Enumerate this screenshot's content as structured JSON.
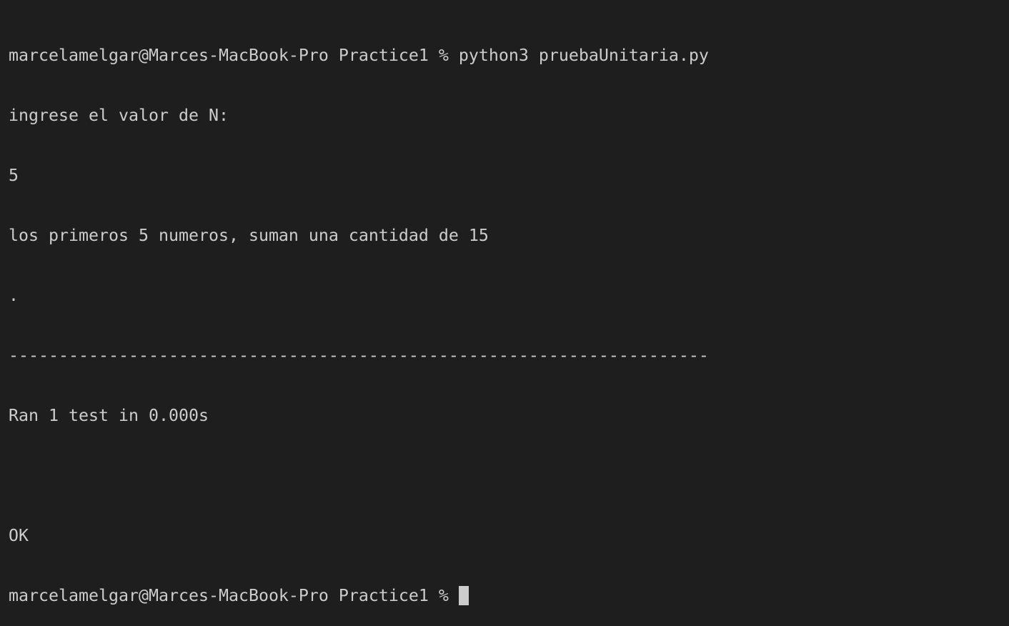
{
  "terminal": {
    "lines": [
      "marcelamelgar@Marces-MacBook-Pro Practice1 % python3 pruebaUnitaria.py",
      "ingrese el valor de N:",
      "5",
      "los primeros 5 numeros, suman una cantidad de 15",
      ".",
      "----------------------------------------------------------------------",
      "Ran 1 test in 0.000s",
      "",
      "OK"
    ],
    "prompt": "marcelamelgar@Marces-MacBook-Pro Practice1 %"
  },
  "colors": {
    "background": "#1e1e1e",
    "text": "#cccccc"
  }
}
